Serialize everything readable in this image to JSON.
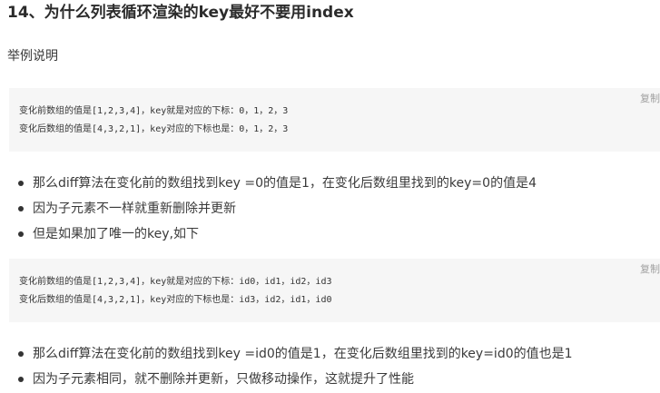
{
  "heading": "14、为什么列表循环渲染的key最好不要用index",
  "intro": "举例说明",
  "copy_label": "复制",
  "code_block_1": [
    "变化前数组的值是[1,2,3,4]，key就是对应的下标：0，1，2，3",
    "变化后数组的值是[4,3,2,1]，key对应的下标也是：0，1，2，3"
  ],
  "bullets_1": [
    "那么diff算法在变化前的数组找到key =0的值是1，在变化后数组里找到的key=0的值是4",
    "因为子元素不一样就重新删除并更新",
    "但是如果加了唯一的key,如下"
  ],
  "code_block_2": [
    "变化前数组的值是[1,2,3,4]，key就是对应的下标：id0，id1，id2，id3",
    "变化后数组的值是[4,3,2,1]，key对应的下标也是：id3，id2，id1，id0"
  ],
  "bullets_2": [
    "那么diff算法在变化前的数组找到key =id0的值是1，在变化后数组里找到的key=id0的值也是1",
    "因为子元素相同，就不删除并更新，只做移动操作，这就提升了性能"
  ]
}
